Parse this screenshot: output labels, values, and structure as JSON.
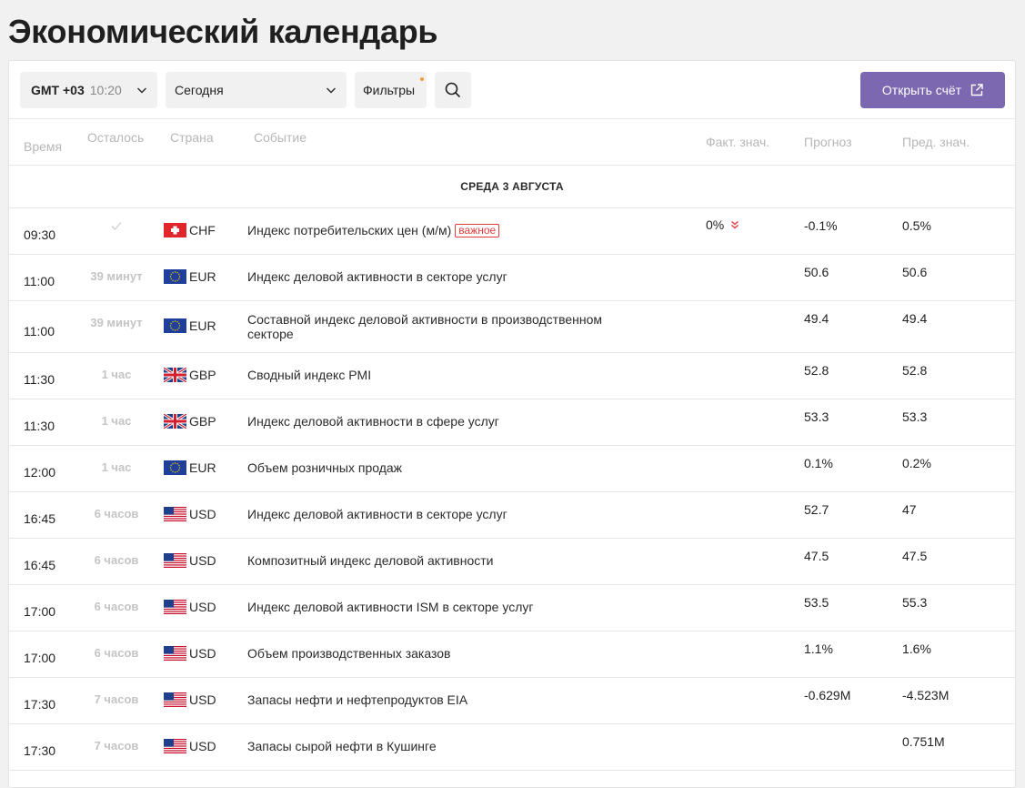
{
  "title": "Экономический календарь",
  "toolbar": {
    "tz_label": "GMT +03",
    "tz_time": "10:20",
    "date_value": "Сегодня",
    "filters_label": "Фильтры",
    "open_account_label": "Открыть счёт"
  },
  "columns": {
    "time": "Время",
    "left": "Осталось",
    "country": "Страна",
    "event": "Событие",
    "actual": "Факт. знач.",
    "forecast": "Прогноз",
    "previous": "Пред. знач."
  },
  "date_header": "СРЕДА 3 АВГУСТА",
  "important_label": "важное",
  "rows": [
    {
      "time": "09:30",
      "left": "",
      "country": "CHF",
      "event": "Индекс потребительских цен (м/м)",
      "actual": "0%",
      "forecast": "-0.1%",
      "previous": "0.5%"
    },
    {
      "time": "11:00",
      "left": "39 минут",
      "country": "EUR",
      "event": "Индекс деловой активности в секторе услуг",
      "actual": "",
      "forecast": "50.6",
      "previous": "50.6"
    },
    {
      "time": "11:00",
      "left": "39 минут",
      "country": "EUR",
      "event": "Составной индекс деловой активности в производственном секторе",
      "actual": "",
      "forecast": "49.4",
      "previous": "49.4"
    },
    {
      "time": "11:30",
      "left": "1 час",
      "country": "GBP",
      "event": "Сводный индекс PMI",
      "actual": "",
      "forecast": "52.8",
      "previous": "52.8"
    },
    {
      "time": "11:30",
      "left": "1 час",
      "country": "GBP",
      "event": "Индекс деловой активности в сфере услуг",
      "actual": "",
      "forecast": "53.3",
      "previous": "53.3"
    },
    {
      "time": "12:00",
      "left": "1 час",
      "country": "EUR",
      "event": "Объем розничных продаж",
      "actual": "",
      "forecast": "0.1%",
      "previous": "0.2%"
    },
    {
      "time": "16:45",
      "left": "6 часов",
      "country": "USD",
      "event": "Индекс деловой активности в секторе услуг",
      "actual": "",
      "forecast": "52.7",
      "previous": "47"
    },
    {
      "time": "16:45",
      "left": "6 часов",
      "country": "USD",
      "event": "Композитный индекс деловой активности",
      "actual": "",
      "forecast": "47.5",
      "previous": "47.5"
    },
    {
      "time": "17:00",
      "left": "6 часов",
      "country": "USD",
      "event": "Индекс деловой активности ISM в секторе услуг",
      "actual": "",
      "forecast": "53.5",
      "previous": "55.3"
    },
    {
      "time": "17:00",
      "left": "6 часов",
      "country": "USD",
      "event": "Объем производственных заказов",
      "actual": "",
      "forecast": "1.1%",
      "previous": "1.6%"
    },
    {
      "time": "17:30",
      "left": "7 часов",
      "country": "USD",
      "event": "Запасы нефти и нефтепродуктов EIA",
      "actual": "",
      "forecast": "-0.629M",
      "previous": "-4.523M"
    },
    {
      "time": "17:30",
      "left": "7 часов",
      "country": "USD",
      "event": "Запасы сырой нефти в Кушинге",
      "actual": "",
      "forecast": "",
      "previous": "0.751M"
    }
  ],
  "colors": {
    "accent": "#7b68b0",
    "important": "#e23b3b"
  }
}
